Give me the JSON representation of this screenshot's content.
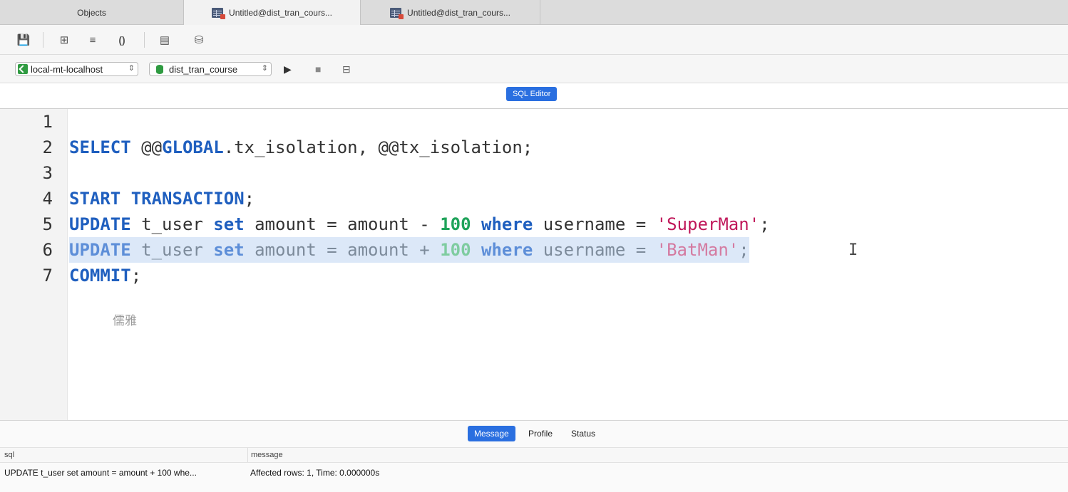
{
  "tabs": [
    {
      "label": "Objects",
      "active": false
    },
    {
      "label": "Untitled@dist_tran_cours...",
      "active": true
    },
    {
      "label": "Untitled@dist_tran_cours...",
      "active": false
    }
  ],
  "toolbar": {
    "save_icon": "💾",
    "format_icon": "⊞",
    "beautify_icon": "≡",
    "paren_icon": "()",
    "snippet_icon": "▤",
    "explain_icon": "⛁"
  },
  "connection": {
    "server": "local-mt-localhost",
    "database": "dist_tran_course",
    "run_icon": "▶",
    "stop_icon": "■",
    "explain_icon": "⊟"
  },
  "editor_label": "SQL Editor",
  "code": {
    "line_numbers": [
      "1",
      "2",
      "3",
      "4",
      "5",
      "6",
      "7"
    ],
    "l2": {
      "select": "SELECT",
      "at1": " @@",
      "global": "GLOBAL",
      "rest": ".tx_isolation, @@tx_isolation;"
    },
    "l4": {
      "start": "START",
      "sp": " ",
      "transaction": "TRANSACTION",
      "semi": ";"
    },
    "l5": {
      "update": "UPDATE",
      "t1": " t_user ",
      "set": "set",
      "t2": " amount = amount - ",
      "num": "100",
      "t3": " ",
      "where": "where",
      "t4": " username = ",
      "str": "'SuperMan'",
      "semi": ";"
    },
    "l6": {
      "update": "UPDATE",
      "t1": " t_user ",
      "set": "set",
      "t2": " amount = amount + ",
      "num": "100",
      "t3": " ",
      "where": "where",
      "t4": " username = ",
      "str": "'BatMan'",
      "semi": ";"
    },
    "l7": {
      "commit": "COMMIT",
      "semi": ";"
    }
  },
  "cursor": "I",
  "watermark": "儒雅",
  "bottom": {
    "tabs": {
      "message": "Message",
      "profile": "Profile",
      "status": "Status"
    },
    "columns": {
      "sql": "sql",
      "message": "message"
    },
    "row": {
      "sql": "UPDATE t_user set amount = amount + 100 whe...",
      "message": "Affected rows: 1, Time: 0.000000s"
    }
  }
}
